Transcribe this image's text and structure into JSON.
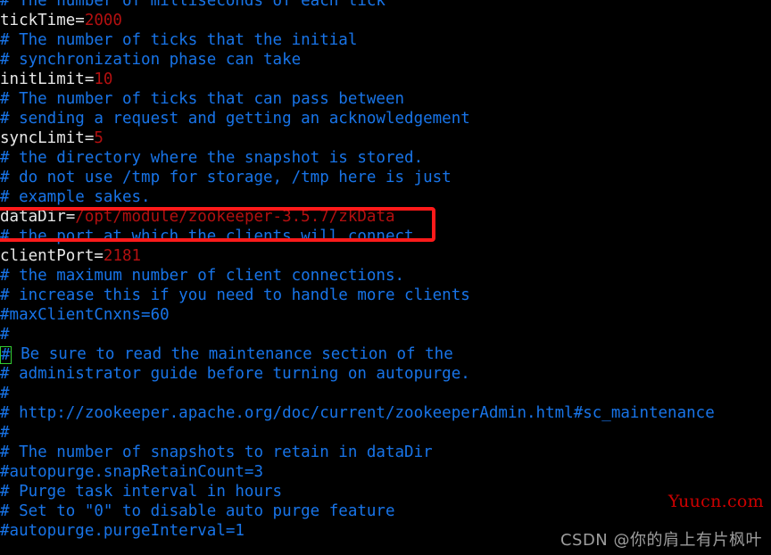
{
  "terminal": {
    "background_color": "#000000",
    "comment_color": "#1874e8",
    "key_color": "#e8e8e8",
    "value_color": "#b31010",
    "cursor_color": "#33cc33",
    "lines": [
      {
        "type": "comment",
        "text": "# The number of milliseconds of each tick"
      },
      {
        "type": "setting",
        "key": "tickTime=",
        "value": "2000"
      },
      {
        "type": "comment",
        "text": "# The number of ticks that the initial"
      },
      {
        "type": "comment",
        "text": "# synchronization phase can take"
      },
      {
        "type": "setting",
        "key": "initLimit=",
        "value": "10"
      },
      {
        "type": "comment",
        "text": "# The number of ticks that can pass between"
      },
      {
        "type": "comment",
        "text": "# sending a request and getting an acknowledgement"
      },
      {
        "type": "setting",
        "key": "syncLimit=",
        "value": "5"
      },
      {
        "type": "comment",
        "text": "# the directory where the snapshot is stored."
      },
      {
        "type": "comment",
        "text": "# do not use /tmp for storage, /tmp here is just"
      },
      {
        "type": "comment",
        "text": "# example sakes."
      },
      {
        "type": "setting",
        "key": "dataDir=",
        "value": "/opt/module/zookeeper-3.5.7/zkData"
      },
      {
        "type": "comment",
        "text": "# the port at which the clients will connect"
      },
      {
        "type": "setting",
        "key": "clientPort=",
        "value": "2181"
      },
      {
        "type": "comment",
        "text": "# the maximum number of client connections."
      },
      {
        "type": "comment",
        "text": "# increase this if you need to handle more clients"
      },
      {
        "type": "comment",
        "text": "#maxClientCnxns=60"
      },
      {
        "type": "comment",
        "text": "#"
      },
      {
        "type": "cursor-comment",
        "cursor_char": "#",
        "text": " Be sure to read the maintenance section of the"
      },
      {
        "type": "comment",
        "text": "# administrator guide before turning on autopurge."
      },
      {
        "type": "comment",
        "text": "#"
      },
      {
        "type": "comment",
        "text": "# http://zookeeper.apache.org/doc/current/zookeeperAdmin.html#sc_maintenance"
      },
      {
        "type": "comment",
        "text": "#"
      },
      {
        "type": "comment",
        "text": "# The number of snapshots to retain in dataDir"
      },
      {
        "type": "comment",
        "text": "#autopurge.snapRetainCount=3"
      },
      {
        "type": "comment",
        "text": "# Purge task interval in hours"
      },
      {
        "type": "comment",
        "text": "# Set to \"0\" to disable auto purge feature"
      },
      {
        "type": "comment",
        "text": "#autopurge.purgeInterval=1"
      }
    ]
  },
  "annotation": {
    "color": "#ff1a1a",
    "target_line": "dataDir=/opt/module/zookeeper-3.5.7/zkData"
  },
  "watermarks": {
    "site": "Yuucn.com",
    "site_color": "#cc0000",
    "csdn": "CSDN @你的肩上有片枫叶",
    "csdn_color": "#9d9d9d"
  }
}
